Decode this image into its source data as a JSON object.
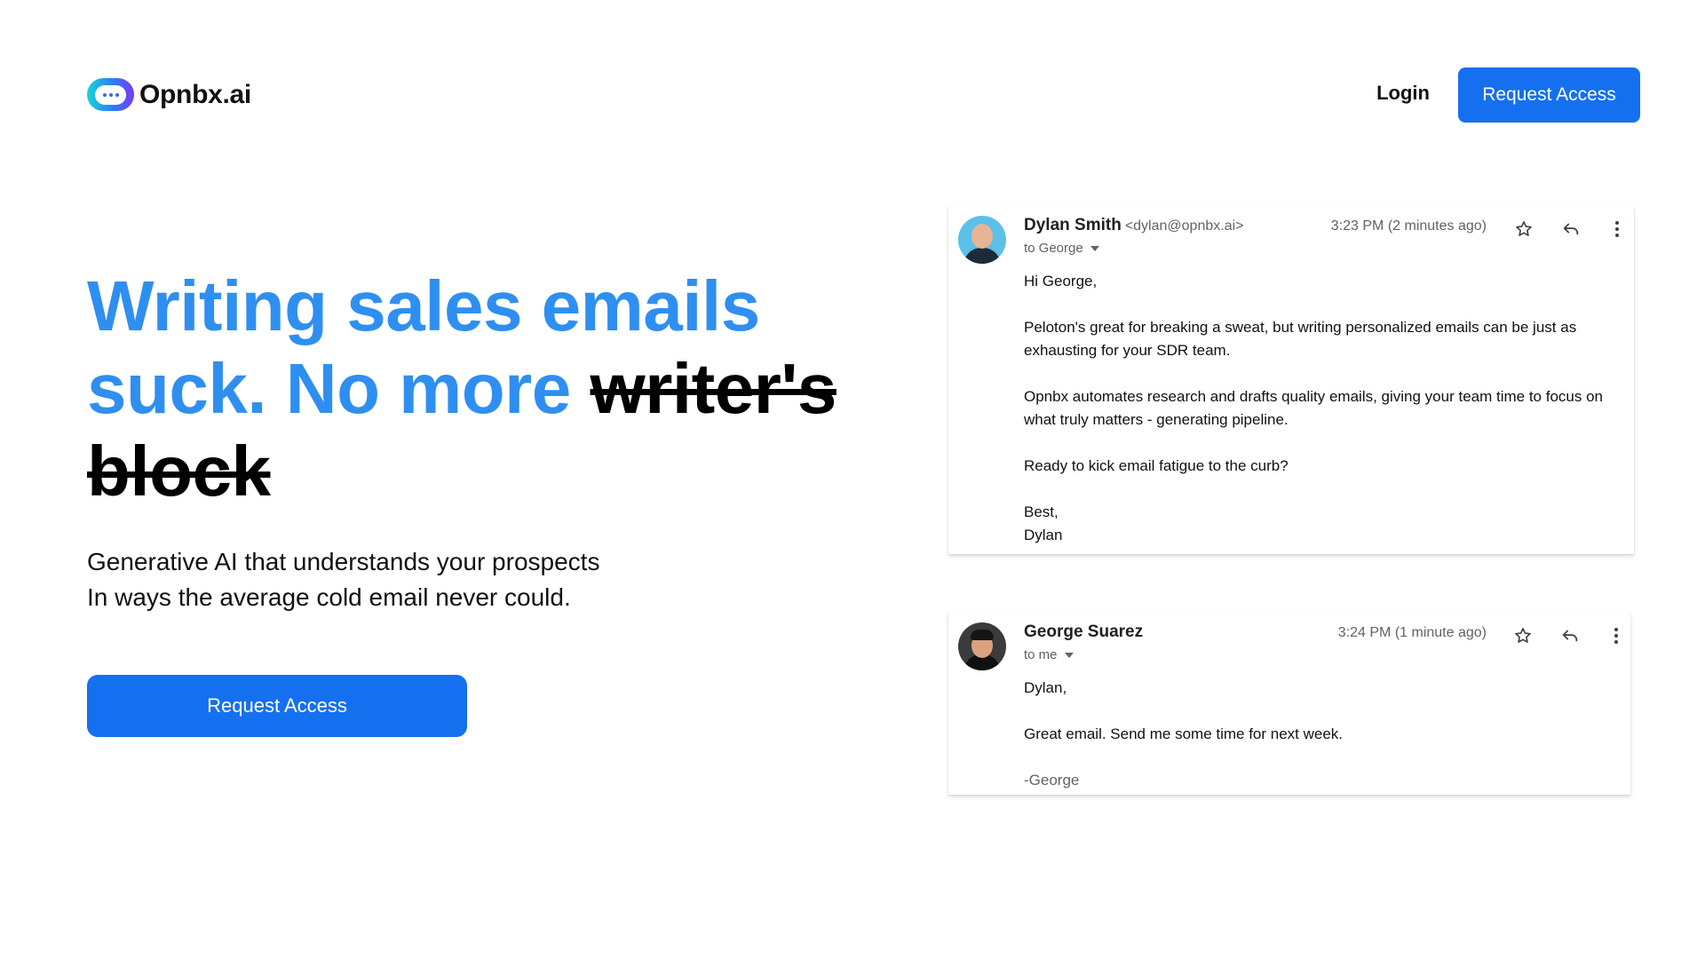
{
  "brand": {
    "name": "Opnbx.ai",
    "icon": "chat-bubble-icon",
    "gradient": [
      "#18d3d8",
      "#2d7cf6",
      "#7b39f4"
    ]
  },
  "nav": {
    "login_label": "Login",
    "cta_label": "Request Access"
  },
  "hero": {
    "headline_blue": "Writing sales emails suck. No more ",
    "headline_strike": "writer's block",
    "subline_1": "Generative AI that understands your prospects",
    "subline_2": "In ways the average cold email never could.",
    "cta_label": "Request Access"
  },
  "colors": {
    "accent": "#1570ef",
    "headline_blue": "#2f8ff0"
  },
  "emails": [
    {
      "sender_name": "Dylan Smith",
      "sender_email": "<dylan@opnbx.ai>",
      "recipient": "to George",
      "timestamp": "3:23 PM (2 minutes ago)",
      "body": [
        "Hi George,",
        "Peloton's great for breaking a sweat, but writing personalized emails can be just as exhausting for your SDR team.",
        "Opnbx automates research and drafts quality emails, giving your team time to focus on what truly matters - generating pipeline.",
        "Ready to kick email fatigue to the curb?"
      ],
      "signoff": "Best,",
      "signature": "Dylan"
    },
    {
      "sender_name": "George Suarez",
      "recipient": "to me",
      "timestamp": "3:24 PM (1 minute ago)",
      "body": [
        "Dylan,",
        "Great email. Send me some time for next week."
      ],
      "signature": "-George"
    }
  ]
}
